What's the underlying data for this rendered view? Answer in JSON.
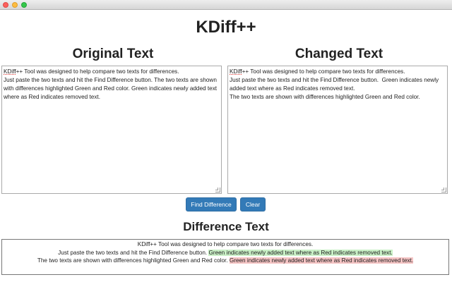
{
  "window": {
    "controls": [
      "close",
      "minimize",
      "zoom"
    ]
  },
  "app": {
    "title": "KDiff++"
  },
  "original": {
    "heading": "Original Text",
    "misspelled_word": "KDiff",
    "text_rest": "++ Tool was designed to help compare two texts for differences.\nJust paste the two texts and hit the Find Difference button. The two texts are shown with differences highlighted Green and Red color. Green indicates newly added text where as Red indicates removed text."
  },
  "changed": {
    "heading": "Changed Text",
    "misspelled_word": "KDiff",
    "text_rest": "++ Tool was designed to help compare two texts for differences.\nJust paste the two texts and hit the Find Difference button.  Green indicates newly added text where as Red indicates removed text.\nThe two texts are shown with differences highlighted Green and Red color."
  },
  "buttons": {
    "find_label": "Find Difference",
    "clear_label": "Clear"
  },
  "difference": {
    "heading": "Difference Text",
    "line1": "KDiff++ Tool was designed to help compare two texts for differences.",
    "line2_plain": "Just paste the two texts and hit the Find Difference button.",
    "line2_added": "Green indicates newly added text where as Red indicates removed text.",
    "line3_plain": "The two texts are shown with differences highlighted Green and Red color.",
    "line3_removed": "Green indicates newly added text where as Red indicates removed text."
  },
  "colors": {
    "button": "#337ab7",
    "added_highlight": "#c9f0c6",
    "removed_highlight": "#f5c4c4"
  }
}
